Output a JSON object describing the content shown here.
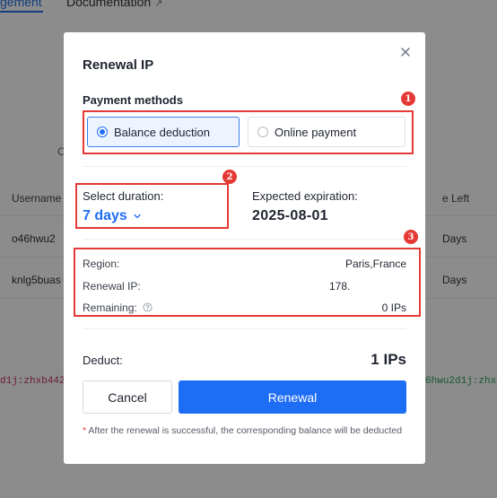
{
  "background": {
    "tabs": [
      {
        "label": "gement"
      },
      {
        "label": "Documentation"
      }
    ],
    "partial_c": "C",
    "table_headers": {
      "username": "Username",
      "time_left": "e Left"
    },
    "rows": [
      {
        "username": "o46hwu2",
        "time_left": "Days"
      },
      {
        "username": "knlg5buas",
        "time_left": "Days"
      }
    ],
    "credential_left": "d1j:zhxb442",
    "credential_right": "6hwu2d1j:zhx"
  },
  "modal": {
    "title": "Renewal IP",
    "payment_methods": {
      "label": "Payment methods",
      "options": [
        {
          "label": "Balance deduction",
          "selected": true
        },
        {
          "label": "Online payment",
          "selected": false
        }
      ]
    },
    "duration": {
      "label": "Select duration:",
      "value": "7 days"
    },
    "expiration": {
      "label": "Expected expiration:",
      "value": "2025-08-01"
    },
    "info": {
      "region_label": "Region:",
      "region_value": "Paris,France",
      "ip_label": "Renewal IP:",
      "ip_value": "178.",
      "remaining_label": "Remaining:",
      "remaining_value": "0 IPs"
    },
    "deduct": {
      "label": "Deduct:",
      "value": "1 IPs"
    },
    "buttons": {
      "cancel": "Cancel",
      "renewal": "Renewal"
    },
    "note_star": "*",
    "note": " After the renewal is successful, the corresponding balance will be deducted"
  },
  "annotations": [
    "1",
    "2",
    "3"
  ],
  "colors": {
    "accent": "#1e6df5",
    "annotation": "#e53935",
    "overlay": "rgba(0,0,0,0.45)"
  }
}
